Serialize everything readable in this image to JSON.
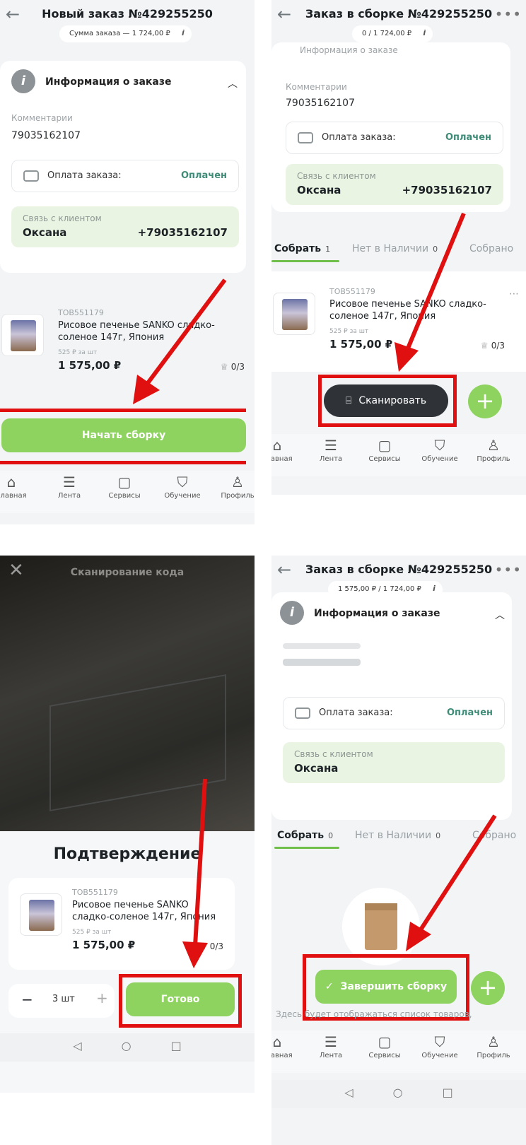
{
  "panels": {
    "new_order": {
      "title": "Новый заказ №429255250",
      "sum_pill": "Сумма заказа — 1 724,00 ₽",
      "info_title": "Информация о заказе",
      "comment_label": "Комментарии",
      "phone": "79035162107",
      "payment_label": "Оплата заказа:",
      "payment_status": "Оплачен",
      "contact_label": "Связь с клиентом",
      "contact_name": "Оксана",
      "contact_phone": "+79035162107",
      "product": {
        "code": "ТОВ551179",
        "name": "Рисовое печенье SANKO сладко-соленое 147г, Япония",
        "unit_price": "525 ₽ за шт",
        "price": "1 575,00 ₽",
        "qty": "0/3"
      },
      "start_button": "Начать сборку"
    },
    "assembling": {
      "title": "Заказ в сборке №429255250",
      "sum_pill": "0 / 1 724,00 ₽",
      "info_title": "Информация о заказе",
      "comment_label": "Комментарии",
      "phone": "79035162107",
      "payment_label": "Оплата заказа:",
      "payment_status": "Оплачен",
      "contact_label": "Связь с клиентом",
      "contact_name": "Оксана",
      "contact_phone": "+79035162107",
      "tabs": [
        {
          "label": "Собрать",
          "count": "1"
        },
        {
          "label": "Нет в Наличии",
          "count": "0"
        },
        {
          "label": "Собрано",
          "count": ""
        }
      ],
      "product": {
        "code": "ТОВ551179",
        "name": "Рисовое печенье SANKO сладко-соленое 147г, Япония",
        "unit_price": "525 ₽ за шт",
        "price": "1 575,00 ₽",
        "qty": "0/3"
      },
      "scan_button": "Сканировать"
    },
    "scanner": {
      "title": "Сканирование кода",
      "confirm_title": "Подтверждение",
      "product": {
        "code": "ТОВ551179",
        "name": "Рисовое печенье SANKO сладко-соленое 147г, Япония",
        "unit_price": "525 ₽ за шт",
        "price": "1 575,00 ₽",
        "qty": "0/3"
      },
      "stepper_value": "3 шт",
      "done_button": "Готово"
    },
    "finishing": {
      "title": "Заказ в сборке №429255250",
      "sum_pill": "1 575,00 ₽ / 1 724,00 ₽",
      "info_title": "Информация о заказе",
      "payment_label": "Оплата заказа:",
      "payment_status": "Оплачен",
      "contact_label": "Связь с клиентом",
      "contact_name": "Оксана",
      "tabs": [
        {
          "label": "Собрать",
          "count": "0"
        },
        {
          "label": "Нет в Наличии",
          "count": "0"
        },
        {
          "label": "Собрано",
          "count": ""
        }
      ],
      "finish_button": "Завершить сборку",
      "hint": "Здесь будет отображаться список товаров,"
    }
  },
  "bottom_nav": [
    {
      "icon": "home-icon",
      "label": "Главная"
    },
    {
      "icon": "feed-icon",
      "label": "Лента"
    },
    {
      "icon": "services-icon",
      "label": "Сервисы"
    },
    {
      "icon": "education-icon",
      "label": "Обучение"
    },
    {
      "icon": "profile-icon",
      "label": "Профиль"
    }
  ],
  "colors": {
    "accent_green": "#8ed35f",
    "paid_green": "#3e8c78",
    "highlight_red": "#e01010",
    "dark_button": "#2f3338"
  }
}
